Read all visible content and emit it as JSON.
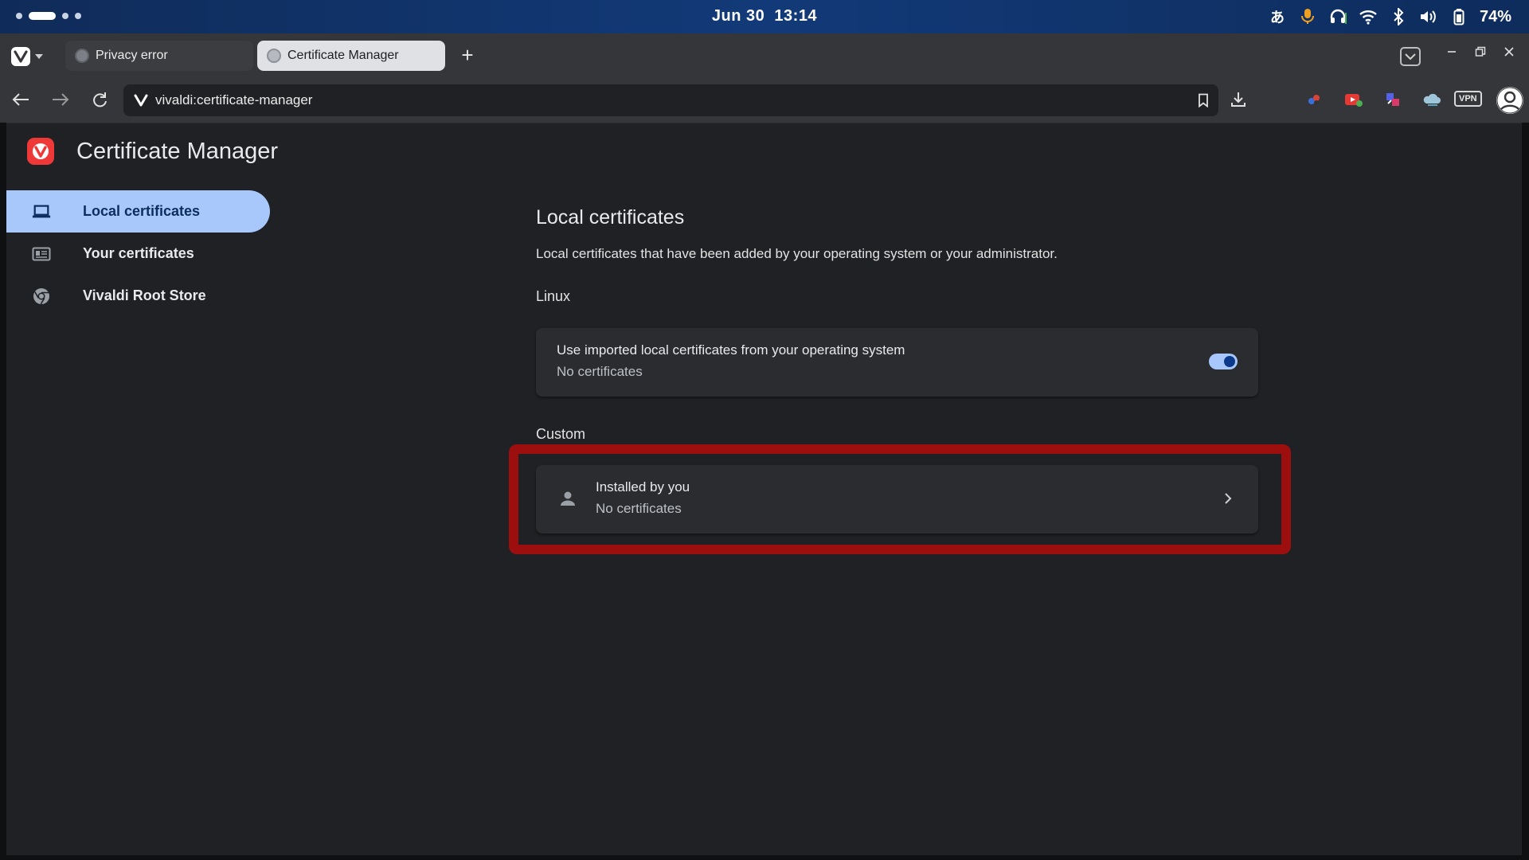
{
  "os": {
    "date": "Jun 30",
    "time": "13:14",
    "ime_label": "あ",
    "battery": "74%"
  },
  "tabs": [
    {
      "label": "Privacy error",
      "active": false
    },
    {
      "label": "Certificate Manager",
      "active": true
    }
  ],
  "address": {
    "url": "vivaldi:certificate-manager",
    "vpn_label": "VPN"
  },
  "page": {
    "title": "Certificate Manager",
    "sidebar": [
      {
        "label": "Local certificates",
        "icon": "laptop-icon",
        "active": true
      },
      {
        "label": "Your certificates",
        "icon": "id-card-icon",
        "active": false
      },
      {
        "label": "Vivaldi Root Store",
        "icon": "chrome-logo-icon",
        "active": false
      }
    ],
    "section_title": "Local certificates",
    "description": "Local certificates that have been added by your operating system or your administrator.",
    "linux": {
      "heading": "Linux",
      "card_title": "Use imported local certificates from your operating system",
      "card_sub": "No certificates",
      "toggle_on": true
    },
    "custom": {
      "heading": "Custom",
      "card_title": "Installed by you",
      "card_sub": "No certificates"
    }
  },
  "colors": {
    "accent": "#a8c7fa",
    "highlight": "#9d0f0f",
    "vivaldi_red": "#ef3939"
  }
}
